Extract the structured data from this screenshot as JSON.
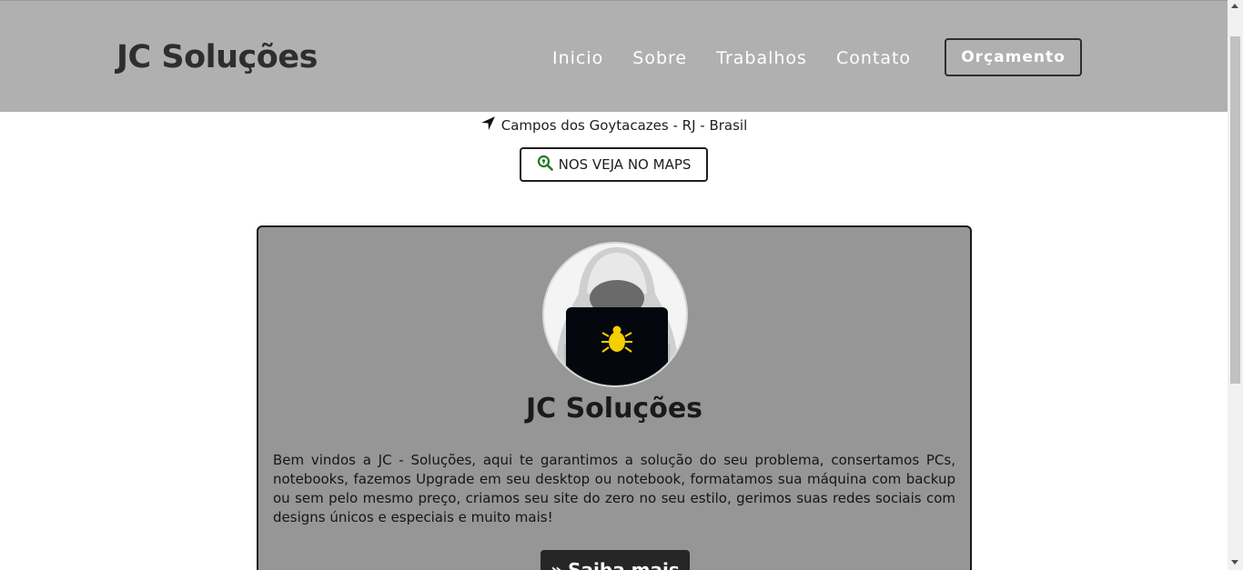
{
  "header": {
    "brand": "JC Soluções",
    "nav": [
      "Inicio",
      "Sobre",
      "Trabalhos",
      "Contato"
    ],
    "quote_button": "Orçamento"
  },
  "location": {
    "text": "Campos dos Goytacazes - RJ - Brasil",
    "icon": "location-arrow-icon",
    "maps_button": "NOS VEJA NO MAPS",
    "maps_icon": "map-search-icon"
  },
  "card": {
    "title": "JC Soluções",
    "text": "Bem vindos a JC - Soluções, aqui te garantimos a solução do seu problema, consertamos PCs, notebooks, fazemos Upgrade em seu desktop ou notebook, formatamos sua máquina com backup ou sem pelo mesmo preço, criamos seu site do zero no seu estilo, gerimos suas redes sociais com designs únicos e especiais e muito mais!",
    "more_button": "Saiba mais",
    "more_icon": "double-chevron-right-icon",
    "avatar_icon": "hacker-avatar-icon"
  },
  "colors": {
    "header_bg": "#b0b0b0",
    "card_bg": "#969696",
    "maps_icon_color": "#1e7a1e",
    "bug_color": "#f5d000"
  }
}
